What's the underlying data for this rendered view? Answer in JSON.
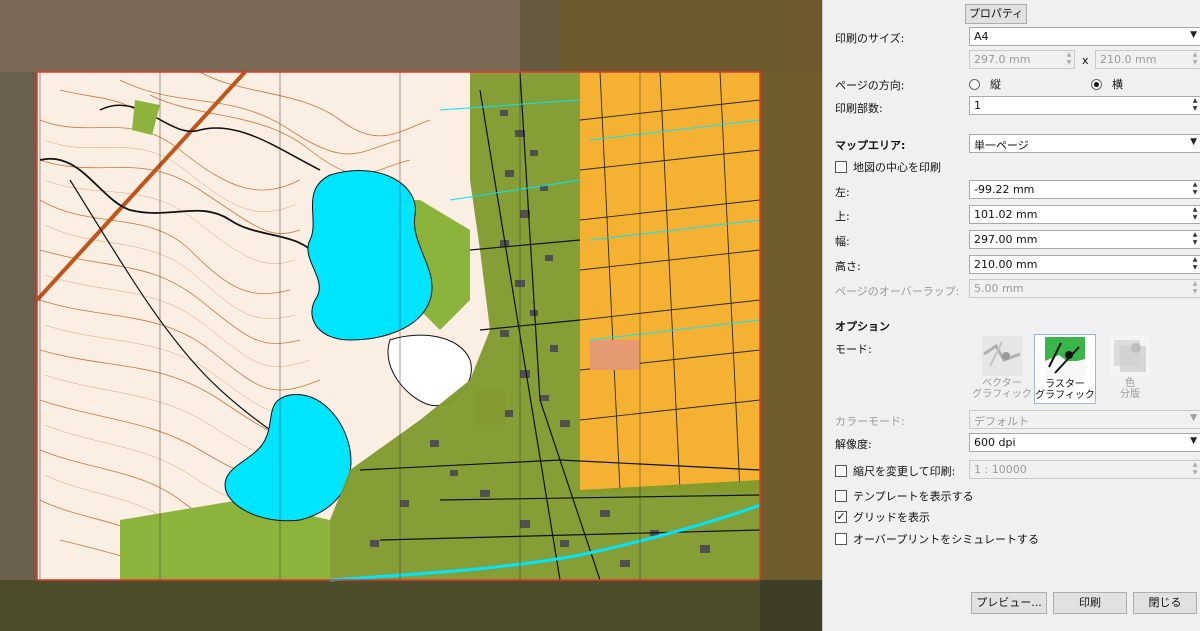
{
  "panel": {
    "properties_button": "プロパティ",
    "paper_size": {
      "label": "印刷のサイズ:",
      "value": "A4",
      "width": "297.0 mm",
      "x": "x",
      "height": "210.0 mm"
    },
    "orientation": {
      "label": "ページの方向:",
      "portrait": "縦",
      "landscape": "横",
      "selected": "landscape"
    },
    "copies": {
      "label": "印刷部数:",
      "value": "1"
    },
    "map_area": {
      "label": "マップエリア:",
      "value": "単一ページ"
    },
    "center_print": {
      "label": "地図の中心を印刷",
      "checked": false
    },
    "left": {
      "label": "左:",
      "value": "-99.22 mm"
    },
    "top": {
      "label": "上:",
      "value": "101.02 mm"
    },
    "width": {
      "label": "幅:",
      "value": "297.00 mm"
    },
    "height": {
      "label": "高さ:",
      "value": "210.00 mm"
    },
    "overlap": {
      "label": "ページのオーバーラップ:",
      "value": "5.00 mm"
    },
    "options": {
      "heading": "オプション",
      "mode_label": "モード:",
      "modes": [
        {
          "line1": "ベクター",
          "line2": "グラフィック",
          "state": "disabled"
        },
        {
          "line1": "ラスター",
          "line2": "グラフィック",
          "state": "selected"
        },
        {
          "line1": "色",
          "line2": "分版",
          "state": "disabled"
        }
      ],
      "color_mode": {
        "label": "カラーモード:",
        "value": "デフォルト"
      },
      "resolution": {
        "label": "解像度:",
        "value": "600 dpi"
      },
      "scale_change": {
        "label": "縮尺を変更して印刷:",
        "value": "1 : 10000",
        "checked": false
      },
      "show_template": {
        "label": "テンプレートを表示する",
        "checked": false
      },
      "show_grid": {
        "label": "グリッドを表示",
        "checked": true
      },
      "simulate_overprint": {
        "label": "オーバープリントをシミュレートする",
        "checked": false
      }
    },
    "buttons": {
      "preview": "プレビュー...",
      "print": "印刷",
      "close": "閉じる"
    }
  },
  "colors": {
    "water": "#00e5ff",
    "contour": "#c5692c",
    "field": "#f5b232",
    "vegetation": "#8cb43c",
    "page_border": "#e3372a"
  }
}
